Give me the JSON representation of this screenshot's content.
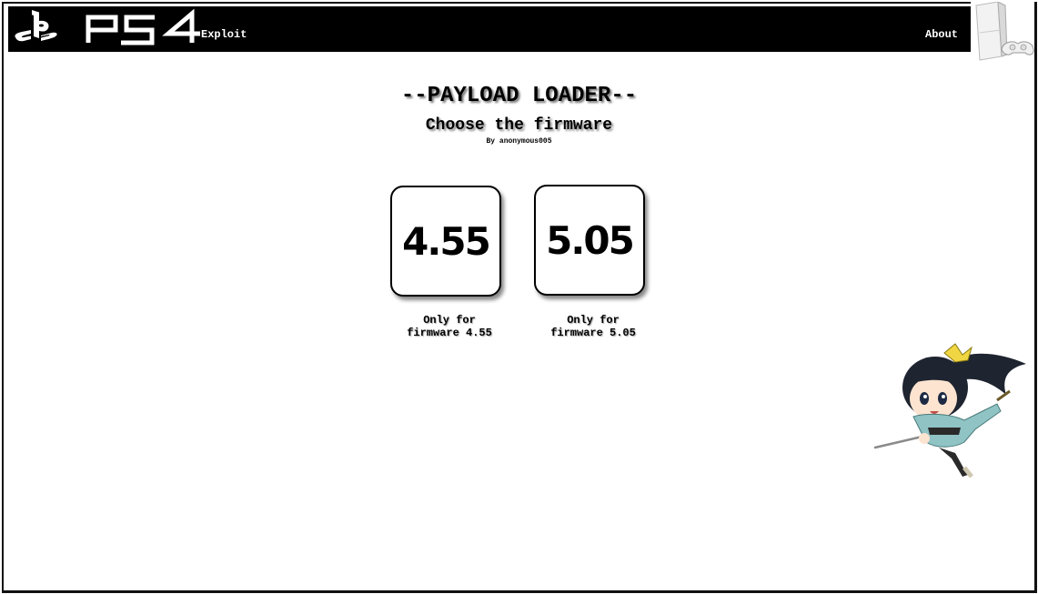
{
  "header": {
    "logo_icon": "ps4-logo-icon",
    "nav_exploit": "Exploit",
    "nav_about": "About",
    "console_icon": "ps4-console-icon"
  },
  "main": {
    "title": "--PAYLOAD LOADER--",
    "subtitle": "Choose the firmware",
    "author": "By anonymous005",
    "firmwares": [
      {
        "label": "4.55",
        "caption_line1": "Only for",
        "caption_line2": "firmware 4.55"
      },
      {
        "label": "5.05",
        "caption_line1": "Only for",
        "caption_line2": "firmware 5.05"
      }
    ]
  },
  "decor": {
    "mascot_icon": "chibi-samurai-girl-icon"
  },
  "colors": {
    "header_bg": "#000000",
    "text": "#000000",
    "page_bg": "#ffffff"
  }
}
